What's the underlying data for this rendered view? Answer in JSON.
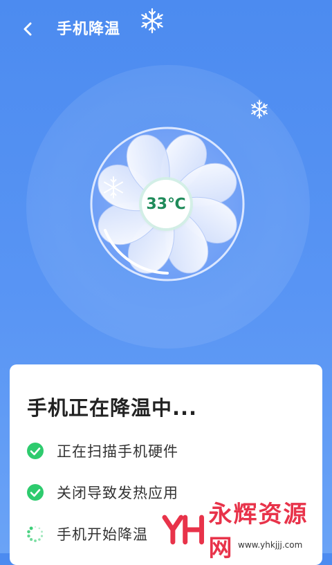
{
  "header": {
    "title": "手机降温",
    "back_icon": "chevron-left-icon"
  },
  "cooling": {
    "temperature": "33℃"
  },
  "status_card": {
    "title": "手机正在降温中...",
    "steps": [
      {
        "label": "正在扫描手机硬件",
        "state": "done",
        "icon": "check-circle-icon"
      },
      {
        "label": "关闭导致发热应用",
        "state": "done",
        "icon": "check-circle-icon"
      },
      {
        "label": "手机开始降温",
        "state": "in-progress",
        "icon": "loading-spinner-icon"
      }
    ]
  },
  "watermark": {
    "text": "永辉资源网",
    "url": "www.yhkjjj.com"
  },
  "colors": {
    "background": "#4c8bf0",
    "check_green": "#2ecb6e",
    "temperature_text": "#1f8b5a",
    "watermark_red": "#e8334a"
  }
}
